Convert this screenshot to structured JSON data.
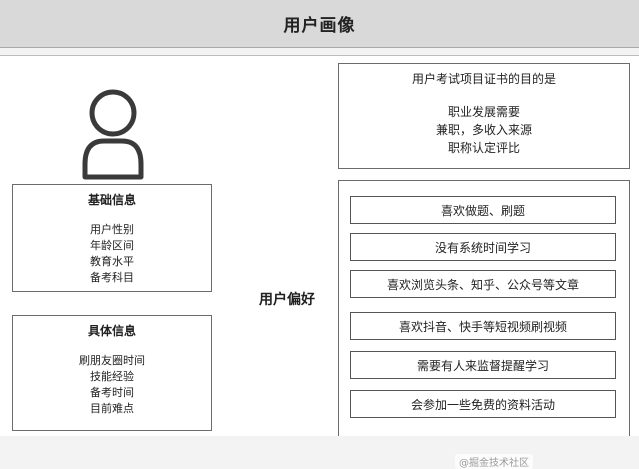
{
  "header": {
    "title": "用户画像"
  },
  "basic_info": {
    "title": "基础信息",
    "items": [
      "用户性别",
      "年龄区间",
      "教育水平",
      "备考科目"
    ]
  },
  "specific_info": {
    "title": "具体信息",
    "items": [
      "刷朋友圈时间",
      "技能经验",
      "备考时间",
      "目前难点"
    ]
  },
  "goal": {
    "title": "用户考试项目证书的目的是",
    "items": [
      "职业发展需要",
      "兼职，多收入来源",
      "职称认定评比"
    ]
  },
  "preferences": {
    "label": "用户偏好",
    "items": [
      "喜欢做题、刷题",
      "没有系统时间学习",
      "喜欢浏览头条、知乎、公众号等文章",
      "喜欢抖音、快手等短视频刷视频",
      "需要有人来监督提醒学习",
      "会参加一些免费的资料活动"
    ]
  },
  "watermark": "@掘金技术社区"
}
